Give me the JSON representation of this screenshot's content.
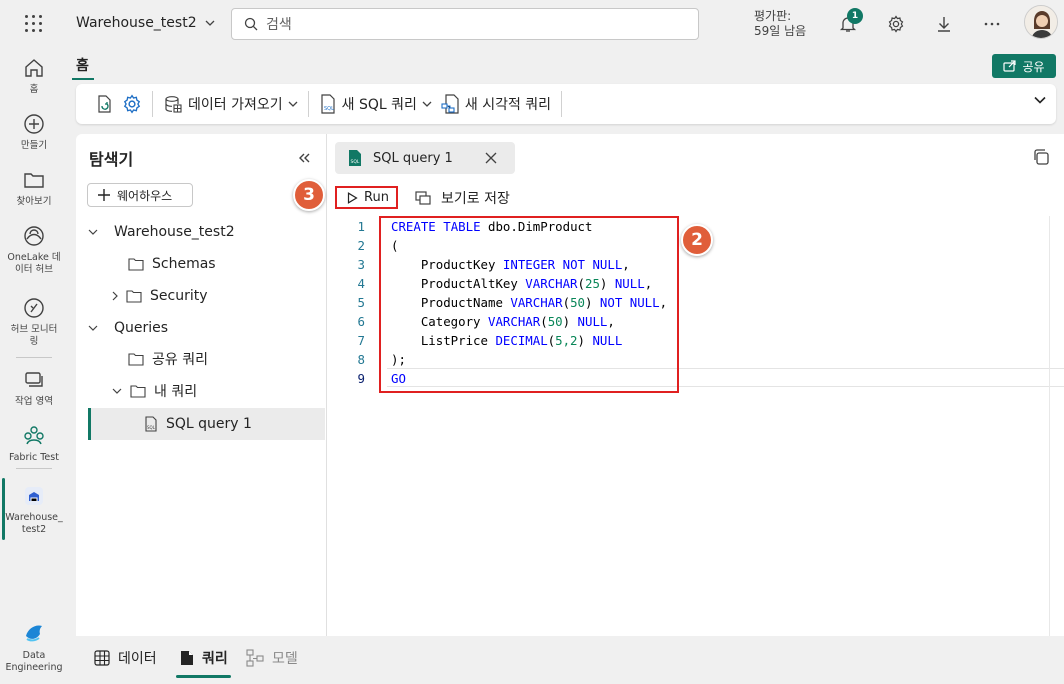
{
  "topbar": {
    "workspace_name": "Warehouse_test2",
    "search_placeholder": "검색",
    "trial_line1": "평가판:",
    "trial_line2": "59일 남음",
    "notification_count": "1"
  },
  "rail": {
    "home": "홈",
    "create": "만들기",
    "browse": "찾아보기",
    "onelake_1": "OneLake 데",
    "onelake_2": "이터 허브",
    "monitor_1": "허브 모니터",
    "monitor_2": "링",
    "workspaces": "작업 영역",
    "fabric_test": "Fabric Test",
    "warehouse_1": "Warehouse_",
    "warehouse_2": "test2",
    "data_eng_1": "Data",
    "data_eng_2": "Engineering"
  },
  "ribbon": {
    "home_tab": "홈",
    "share": "공유",
    "get_data": "데이터 가져오기",
    "new_sql_query": "새 SQL 쿼리",
    "new_visual_query": "새 시각적 쿼리"
  },
  "explorer": {
    "title": "탐색기",
    "add_warehouse": "웨어하우스",
    "tree": {
      "warehouse": "Warehouse_test2",
      "schemas": "Schemas",
      "security": "Security",
      "queries": "Queries",
      "shared_queries": "공유 쿼리",
      "my_queries": "내 쿼리",
      "sql_query_1": "SQL query 1"
    }
  },
  "editor": {
    "tab_label": "SQL query 1",
    "run_label": "Run",
    "save_as_view": "보기로 저장",
    "callout_2": "2",
    "callout_3": "3",
    "line_numbers": [
      "1",
      "2",
      "3",
      "4",
      "5",
      "6",
      "7",
      "8",
      "9"
    ],
    "code": {
      "l1_kw1": "CREATE",
      "l1_kw2": "TABLE",
      "l1_name": "dbo.DimProduct",
      "l2": "(",
      "l3_col": "ProductKey",
      "l3_type": "INTEGER",
      "l3_null": "NOT NULL",
      "l3_end": ",",
      "l4_col": "ProductAltKey",
      "l4_type": "VARCHAR",
      "l4_open": "(",
      "l4_num": "25",
      "l4_close": ")",
      "l4_null": "NULL",
      "l4_end": ",",
      "l5_col": "ProductName",
      "l5_type": "VARCHAR",
      "l5_open": "(",
      "l5_num": "50",
      "l5_close": ")",
      "l5_null": "NOT NULL",
      "l5_end": ",",
      "l6_col": "Category",
      "l6_type": "VARCHAR",
      "l6_open": "(",
      "l6_num": "50",
      "l6_close": ")",
      "l6_null": "NULL",
      "l6_end": ",",
      "l7_col": "ListPrice",
      "l7_type": "DECIMAL",
      "l7_open": "(",
      "l7_num": "5,2",
      "l7_close": ")",
      "l7_null": "NULL",
      "l8": ");",
      "l9": "GO"
    }
  },
  "bottom_tabs": {
    "data": "데이터",
    "query": "쿼리",
    "model": "모델"
  },
  "colors": {
    "accent": "#117865",
    "highlight_red": "#e02020",
    "callout": "#e05e3a",
    "keyword": "#0000ff",
    "number": "#098658"
  }
}
